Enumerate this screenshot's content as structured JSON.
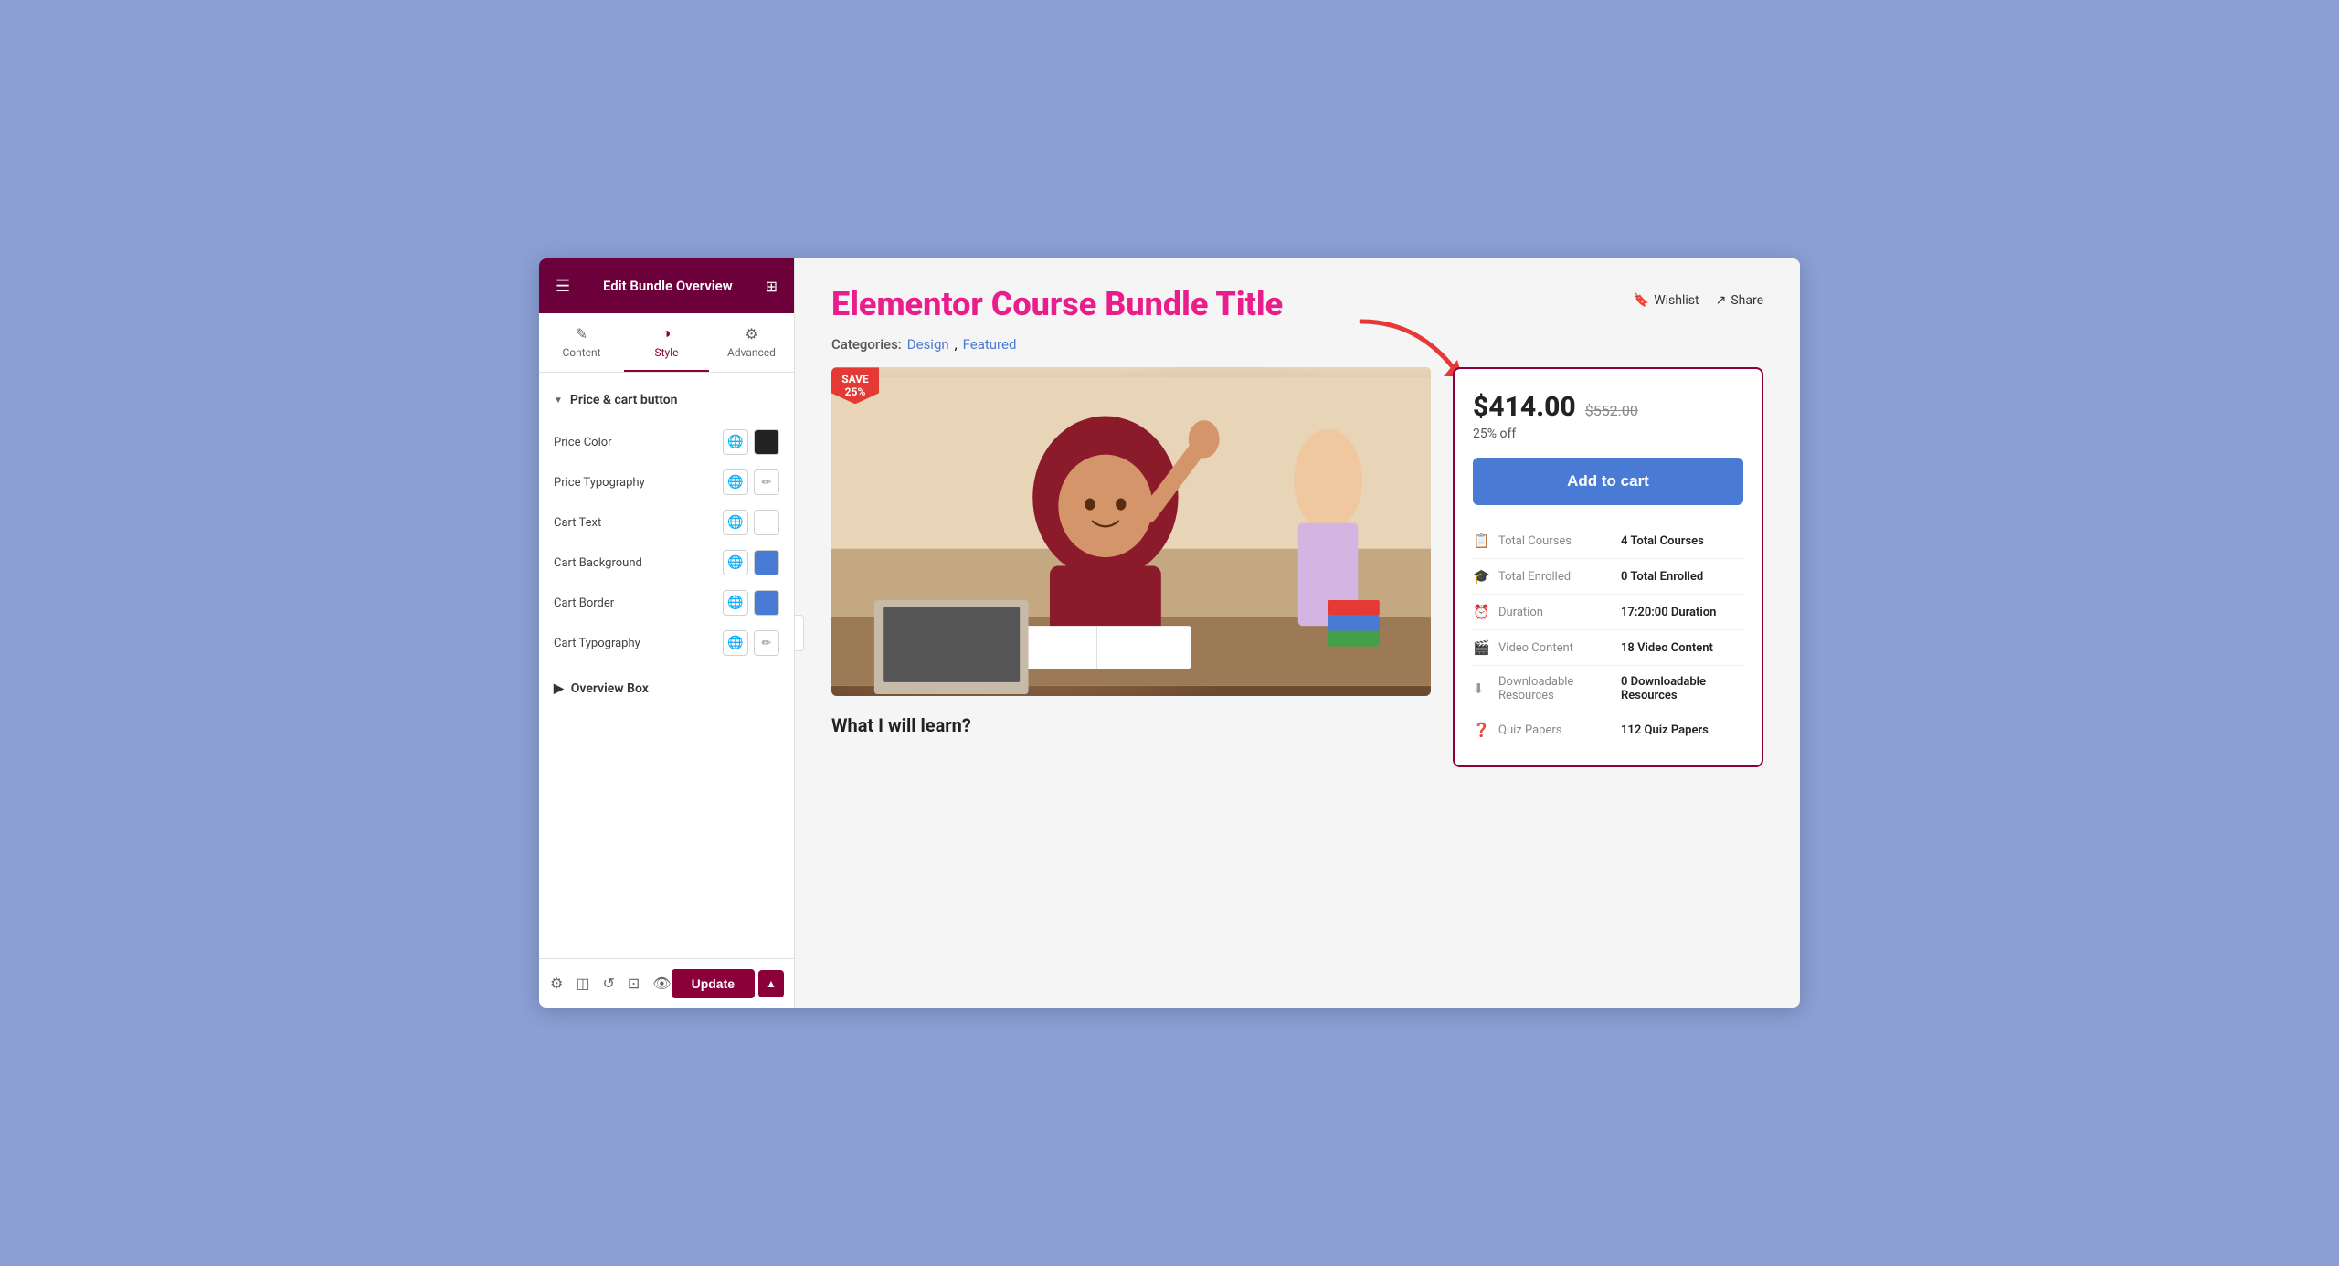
{
  "sidebar": {
    "header": {
      "title": "Edit Bundle Overview",
      "menu_icon": "☰",
      "grid_icon": "⊞"
    },
    "tabs": [
      {
        "id": "content",
        "label": "Content",
        "icon": "✎",
        "active": false
      },
      {
        "id": "style",
        "label": "Style",
        "icon": "◑",
        "active": true
      },
      {
        "id": "advanced",
        "label": "Advanced",
        "icon": "⚙",
        "active": false
      }
    ],
    "sections": [
      {
        "id": "price-cart",
        "label": "Price & cart button",
        "expanded": true,
        "props": [
          {
            "id": "price-color",
            "label": "Price Color",
            "control": "color",
            "color": "black"
          },
          {
            "id": "price-typography",
            "label": "Price Typography",
            "control": "typography"
          },
          {
            "id": "cart-text",
            "label": "Cart Text",
            "control": "color",
            "color": "white"
          },
          {
            "id": "cart-background",
            "label": "Cart Background",
            "control": "color",
            "color": "blue"
          },
          {
            "id": "cart-border",
            "label": "Cart Border",
            "control": "color",
            "color": "blue"
          },
          {
            "id": "cart-typography",
            "label": "Cart Typography",
            "control": "typography"
          }
        ]
      },
      {
        "id": "overview-box",
        "label": "Overview Box",
        "expanded": false
      }
    ],
    "footer": {
      "update_label": "Update",
      "icons": [
        "⚙",
        "◫",
        "↺",
        "⊡",
        "👁"
      ]
    }
  },
  "main": {
    "course_title": "Elementor Course Bundle Title",
    "categories_label": "Categories:",
    "categories": [
      "Design",
      "Featured"
    ],
    "actions": [
      {
        "label": "Wishlist",
        "icon": "🔖"
      },
      {
        "label": "Share",
        "icon": "↗"
      }
    ],
    "save_badge": {
      "line1": "SAVE",
      "line2": "25%"
    },
    "price_card": {
      "current_price": "$414.00",
      "original_price": "$552.00",
      "discount_text": "25% off",
      "add_to_cart_label": "Add to cart",
      "stats": [
        {
          "icon": "📋",
          "key": "Total Courses",
          "value": "4 Total Courses"
        },
        {
          "icon": "🎓",
          "key": "Total Enrolled",
          "value": "0 Total Enrolled"
        },
        {
          "icon": "⏰",
          "key": "Duration",
          "value": "17:20:00 Duration"
        },
        {
          "icon": "🎬",
          "key": "Video Content",
          "value": "18 Video Content"
        },
        {
          "icon": "⬇",
          "key": "Downloadable Resources",
          "value": "0 Downloadable Resources"
        },
        {
          "icon": "❓",
          "key": "Quiz Papers",
          "value": "112 Quiz Papers"
        }
      ]
    },
    "what_learn_label": "What I will learn?"
  },
  "colors": {
    "title": "#e91e8c",
    "cart_btn": "#4a7bd4",
    "sidebar_header": "#6b003a",
    "update_btn": "#8b003a",
    "card_border": "#8b003a",
    "cat_link": "#4a7bd4",
    "save_badge": "#e53935"
  }
}
